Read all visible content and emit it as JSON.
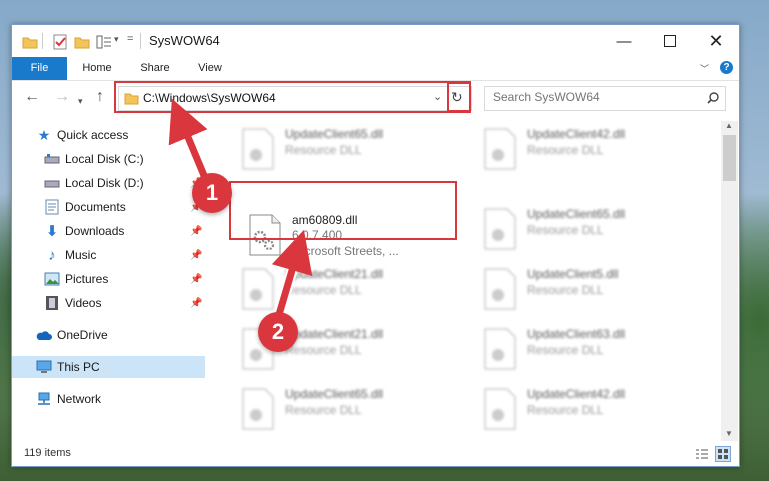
{
  "window": {
    "title": "SysWOW64"
  },
  "ribbon": {
    "tabs": [
      "File",
      "Home",
      "Share",
      "View"
    ]
  },
  "address": {
    "path": "C:\\Windows\\SysWOW64"
  },
  "search": {
    "placeholder": "Search SysWOW64"
  },
  "sidebar": {
    "items": [
      {
        "label": "Quick access",
        "icon": "star-icon"
      },
      {
        "label": "Local Disk (C:)",
        "icon": "drive-icon"
      },
      {
        "label": "Local Disk (D:)",
        "icon": "drive-icon"
      },
      {
        "label": "Documents",
        "icon": "documents-icon"
      },
      {
        "label": "Downloads",
        "icon": "downloads-icon"
      },
      {
        "label": "Music",
        "icon": "music-icon"
      },
      {
        "label": "Pictures",
        "icon": "pictures-icon"
      },
      {
        "label": "Videos",
        "icon": "videos-icon"
      },
      {
        "label": "OneDrive",
        "icon": "cloud-icon"
      },
      {
        "label": "This PC",
        "icon": "computer-icon"
      },
      {
        "label": "Network",
        "icon": "network-icon"
      }
    ]
  },
  "files": [
    {
      "name": "UpdateClient65.dll",
      "type": "Resource DLL"
    },
    {
      "name": "UpdateClient42.dll",
      "type": "Resource DLL"
    },
    {
      "name": "am60809.dll",
      "version": "6.0.7.400",
      "company": "Microsoft Streets, ..."
    },
    {
      "name": "UpdateClient65.dll",
      "type": "Resource DLL"
    },
    {
      "name": "UpdateClient21.dll",
      "type": "Resource DLL"
    },
    {
      "name": "UpdateClient5.dll",
      "type": "Resource DLL"
    },
    {
      "name": "UpdateClient21.dll",
      "type": "Resource DLL"
    },
    {
      "name": "UpdateClient63.dll",
      "type": "Resource DLL"
    },
    {
      "name": "UpdateClient65.dll",
      "type": "Resource DLL"
    },
    {
      "name": "UpdateClient42.dll",
      "type": "Resource DLL"
    }
  ],
  "status": {
    "count": "119 items"
  },
  "annotations": {
    "step1": "1",
    "step2": "2",
    "color": "#d9373d"
  },
  "colors": {
    "accent": "#1979ca",
    "selected": "#cce4f7"
  }
}
